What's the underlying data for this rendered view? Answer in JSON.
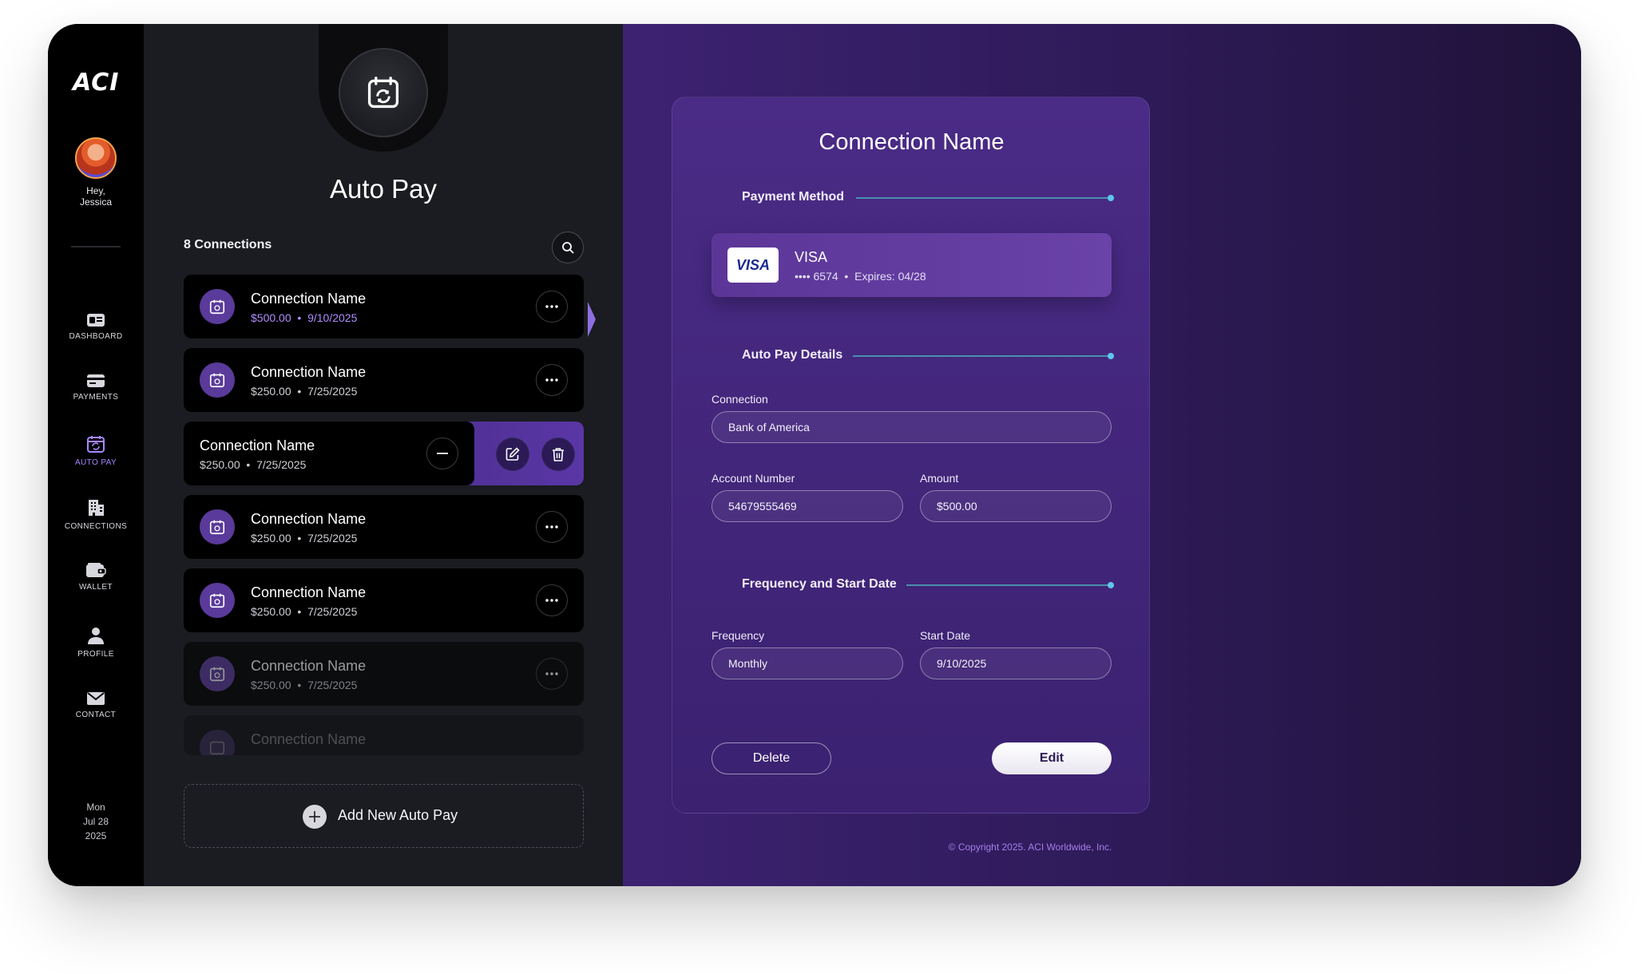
{
  "rail": {
    "logo": "ACI",
    "greeting_line1": "Hey,",
    "greeting_line2": "Jessica",
    "nav": [
      {
        "label": "DASHBOARD",
        "icon": "dashboard-icon"
      },
      {
        "label": "PAYMENTS",
        "icon": "card-icon"
      },
      {
        "label": "AUTO PAY",
        "icon": "calendar-sync-icon",
        "active": true
      },
      {
        "label": "CONNECTIONS",
        "icon": "building-icon"
      },
      {
        "label": "WALLET",
        "icon": "wallet-icon"
      },
      {
        "label": "PROFILE",
        "icon": "person-icon"
      },
      {
        "label": "CONTACT",
        "icon": "envelope-icon"
      }
    ],
    "date": {
      "day": "Mon",
      "date": "Jul 28",
      "year": "2025"
    }
  },
  "list": {
    "title": "Auto Pay",
    "count_label": "8 Connections",
    "rows": [
      {
        "name": "Connection Name",
        "amount": "$500.00",
        "date": "9/10/2025",
        "selected": true
      },
      {
        "name": "Connection Name",
        "amount": "$250.00",
        "date": "7/25/2025"
      },
      {
        "name": "Connection Name",
        "amount": "$250.00",
        "date": "7/25/2025",
        "swiped": true
      },
      {
        "name": "Connection Name",
        "amount": "$250.00",
        "date": "7/25/2025"
      },
      {
        "name": "Connection Name",
        "amount": "$250.00",
        "date": "7/25/2025"
      },
      {
        "name": "Connection Name",
        "amount": "$250.00",
        "date": "7/25/2025"
      },
      {
        "name": "Connection Name",
        "amount": "",
        "date": ""
      }
    ],
    "add_label": "Add New Auto Pay"
  },
  "detail": {
    "title": "Connection Name",
    "payment_method_heading": "Payment Method",
    "card": {
      "badge": "VISA",
      "brand": "VISA",
      "masked": "•••• 6574",
      "expires": "Expires: 04/28"
    },
    "autopay_heading": "Auto Pay Details",
    "connection_label": "Connection",
    "connection_value": "Bank of America",
    "account_label": "Account Number",
    "account_value": "54679555469",
    "amount_label": "Amount",
    "amount_value": "$500.00",
    "frequency_heading": "Frequency and Start Date",
    "frequency_label": "Frequency",
    "frequency_value": "Monthly",
    "start_label": "Start Date",
    "start_value": "9/10/2025",
    "delete_label": "Delete",
    "edit_label": "Edit"
  },
  "copyright": "© Copyright 2025. ACI Worldwide, Inc.",
  "colors": {
    "accent": "#a787ff",
    "rail_bg": "#000000",
    "list_bg": "#1a1c21",
    "detail_bg": "#3d2272",
    "section_dot": "#5ec6ee"
  }
}
